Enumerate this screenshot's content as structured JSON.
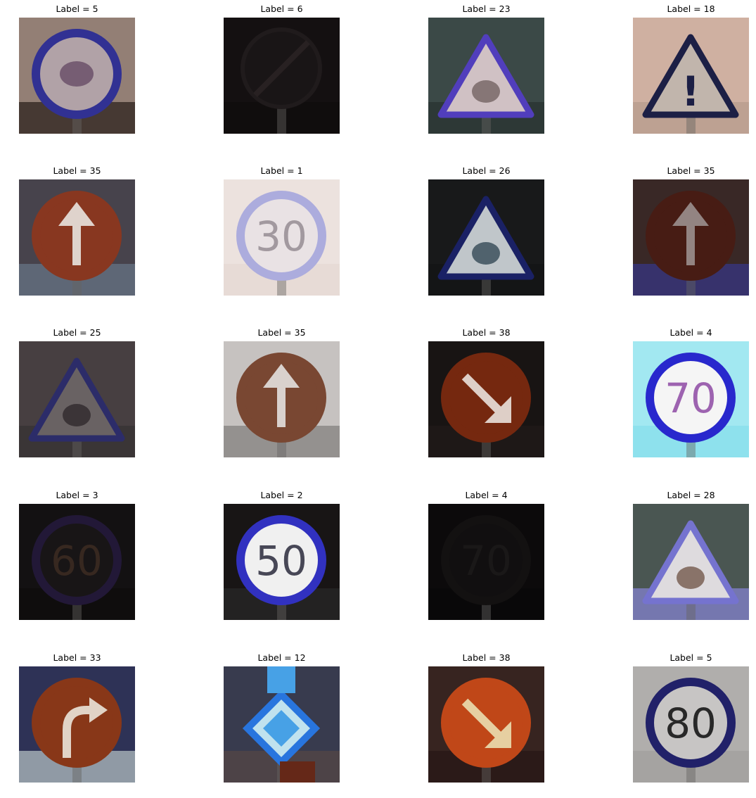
{
  "figure": {
    "images": [
      {
        "label": "Label = 5",
        "sign": "speed-limit-sign",
        "text": "",
        "bg": "#9a857a",
        "ground": "#2e2420",
        "ring": "#33339a",
        "fill": "#b9a9ae",
        "glyph": "#6b4f6a",
        "dim": 1.0
      },
      {
        "label": "Label = 6",
        "sign": "end-limit-sign",
        "text": "",
        "bg": "#151112",
        "ground": "#100d0e",
        "ring": "#221d1e",
        "fill": "#1b1617",
        "glyph": "#2a2324",
        "dim": 1.0
      },
      {
        "label": "Label = 23",
        "sign": "warning-triangle",
        "text": "",
        "bg": "#3e4c4a",
        "ground": "#2b3534",
        "ring": "#5541c4",
        "fill": "#d9c9cc",
        "glyph": "#6b5a58",
        "dim": 1.0
      },
      {
        "label": "Label = 18",
        "sign": "warning-triangle",
        "text": "!",
        "bg": "#d8b8a8",
        "ground": "#bfa393",
        "ring": "#1e2148",
        "fill": "#c9bdb3",
        "glyph": "#1e2148",
        "dim": 1.0
      },
      {
        "label": "Label = 35",
        "sign": "arrow-up-sign",
        "text": "",
        "bg": "#4a4650",
        "ground": "#6b7a8a",
        "ring": "#8e3a22",
        "fill": "#8e3a22",
        "glyph": "#e9dcd5",
        "dim": 1.0
      },
      {
        "label": "Label = 1",
        "sign": "speed-limit-sign",
        "text": "30",
        "bg": "#f6ece8",
        "ground": "#efe2dc",
        "ring": "#b3b3e6",
        "fill": "#f3ecee",
        "glyph": "#a9a0a6",
        "dim": 1.0
      },
      {
        "label": "Label = 26",
        "sign": "warning-triangle",
        "text": "",
        "bg": "#1a1b1c",
        "ground": "#141516",
        "ring": "#1c236a",
        "fill": "#c8cfd3",
        "glyph": "#223a48",
        "dim": 1.0
      },
      {
        "label": "Label = 35",
        "sign": "arrow-up-sign",
        "text": "",
        "bg": "#3c2a28",
        "ground": "#3a3a8a",
        "ring": "#4a1e15",
        "fill": "#4a1e15",
        "glyph": "#9a8a88",
        "dim": 1.0
      },
      {
        "label": "Label = 25",
        "sign": "warning-triangle",
        "text": "",
        "bg": "#4a4244",
        "ground": "#3a3536",
        "ring": "#2e2e6e",
        "fill": "#6e6668",
        "glyph": "#2a2426",
        "dim": 1.0
      },
      {
        "label": "Label = 35",
        "sign": "arrow-up-sign",
        "text": "",
        "bg": "#cfcac8",
        "ground": "#8a8684",
        "ring": "#7e4a35",
        "fill": "#7e4a35",
        "glyph": "#e2dad6",
        "dim": 1.0
      },
      {
        "label": "Label = 38",
        "sign": "arrow-diag-sign",
        "text": "",
        "bg": "#1a1514",
        "ground": "#231c1a",
        "ring": "#7a2a10",
        "fill": "#7a2a10",
        "glyph": "#e8d8d0",
        "dim": 1.0
      },
      {
        "label": "Label = 4",
        "sign": "speed-limit-sign",
        "text": "70",
        "bg": "#a9f2fb",
        "ground": "#8ee8f6",
        "ring": "#2a2ad6",
        "fill": "#ffffff",
        "glyph": "#a468b8",
        "dim": 1.0
      },
      {
        "label": "Label = 3",
        "sign": "speed-limit-sign",
        "text": "60",
        "bg": "#141213",
        "ground": "#0f0d0e",
        "ring": "#241a3a",
        "fill": "#1a1617",
        "glyph": "#3a2a22",
        "dim": 1.0
      },
      {
        "label": "Label = 2",
        "sign": "speed-limit-sign",
        "text": "50",
        "bg": "#1a1616",
        "ground": "#2a2a2a",
        "ring": "#3434c8",
        "fill": "#fafafa",
        "glyph": "#4a4a5a",
        "dim": 1.0
      },
      {
        "label": "Label = 4",
        "sign": "speed-limit-sign",
        "text": "70",
        "bg": "#0d0b0c",
        "ground": "#0a0909",
        "ring": "#141212",
        "fill": "#121011",
        "glyph": "#1c1a1a",
        "dim": 1.0
      },
      {
        "label": "Label = 28",
        "sign": "warning-triangle",
        "text": "",
        "bg": "#4e5a56",
        "ground": "#8a88d8",
        "ring": "#7a78d8",
        "fill": "#e8e4e8",
        "glyph": "#6a4a3a",
        "dim": 1.0
      },
      {
        "label": "Label = 33",
        "sign": "turn-right-sign",
        "text": "",
        "bg": "#30355a",
        "ground": "#b8c6c8",
        "ring": "#8e3a1a",
        "fill": "#8e3a1a",
        "glyph": "#ebdccf",
        "dim": 1.0
      },
      {
        "label": "Label = 12",
        "sign": "priority-sign",
        "text": "",
        "bg": "#3b3e52",
        "ground": "#5a4a48",
        "ring": "#2a7ae8",
        "fill": "#c8ecf8",
        "glyph": "#4aa8f0",
        "dim": 1.0
      },
      {
        "label": "Label = 38",
        "sign": "arrow-diag-sign",
        "text": "",
        "bg": "#3a2622",
        "ground": "#2a1a18",
        "ring": "#c84a1a",
        "fill": "#c84a1a",
        "glyph": "#f0d8a8",
        "dim": 1.0
      },
      {
        "label": "Label = 5",
        "sign": "speed-limit-sign",
        "text": "80",
        "bg": "#b8b6b4",
        "ground": "#a8a6a4",
        "ring": "#23236e",
        "fill": "#d0cecc",
        "glyph": "#2a2a2a",
        "dim": 1.0
      }
    ]
  }
}
